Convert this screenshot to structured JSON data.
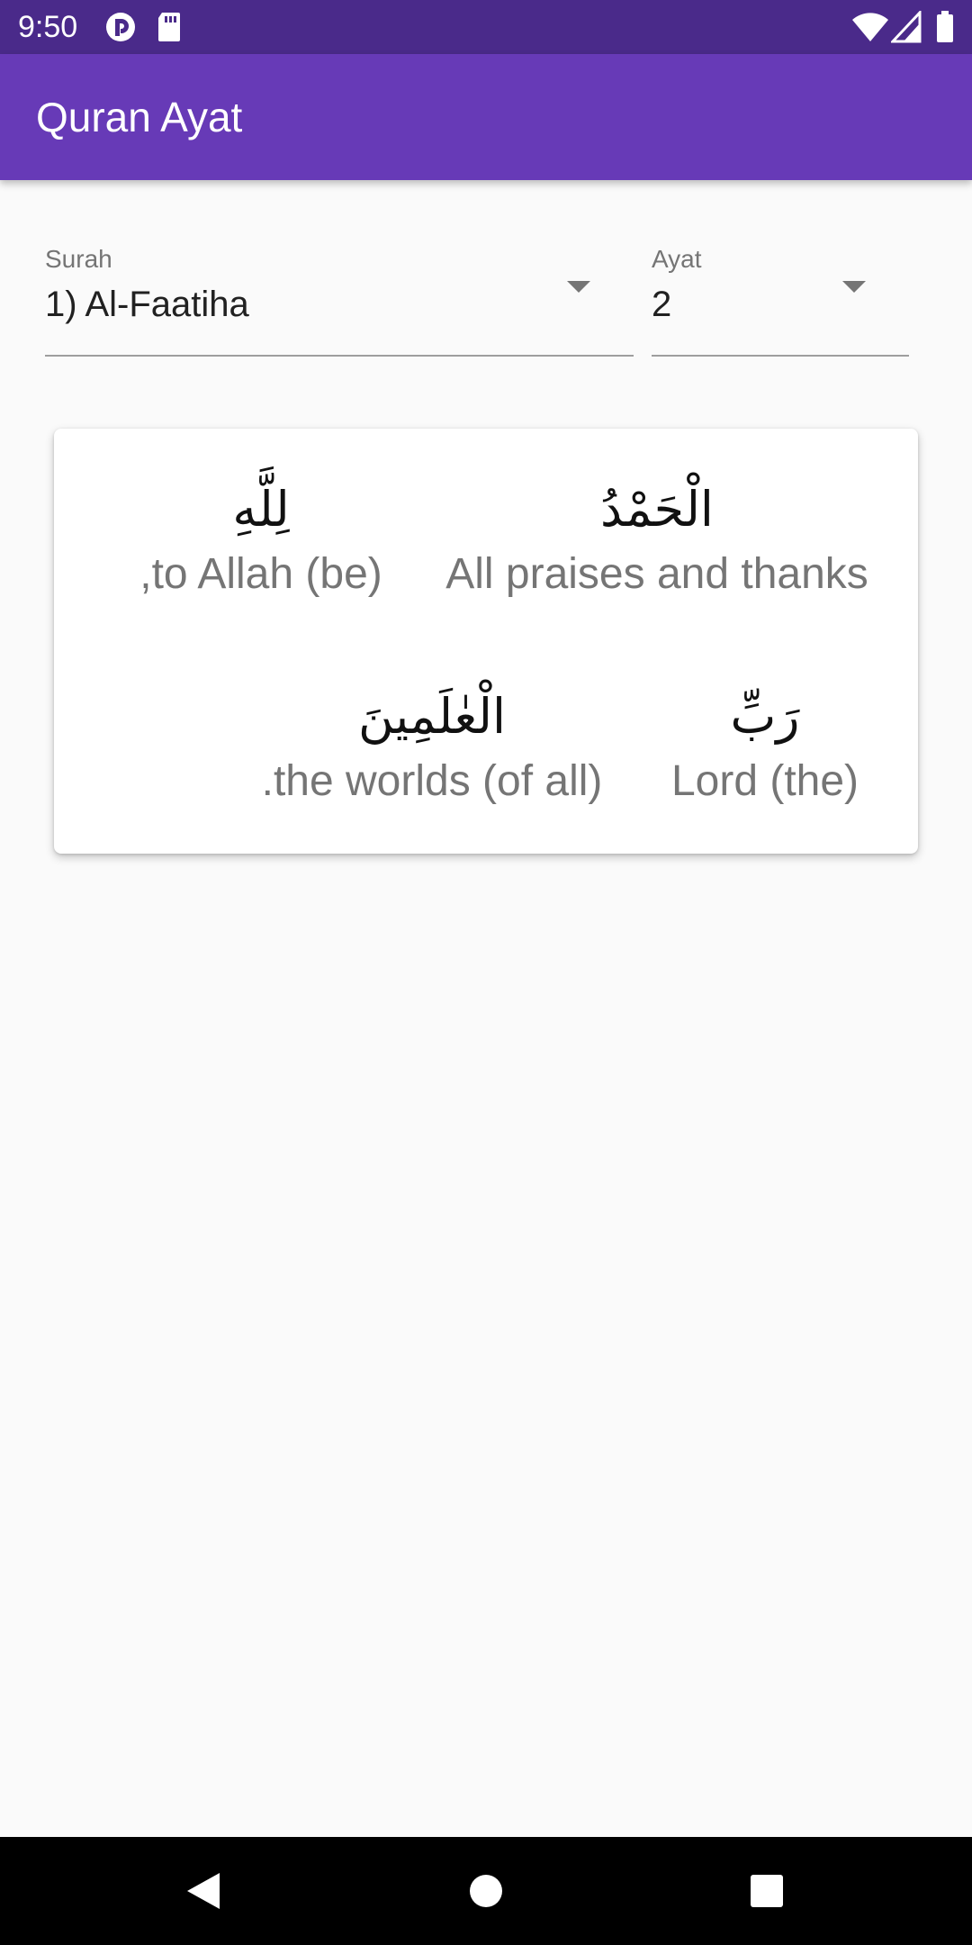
{
  "status_bar": {
    "time": "9:50",
    "icons": [
      "pocket-casts-icon",
      "sd-card-icon",
      "wifi-icon",
      "signal-icon",
      "battery-icon"
    ]
  },
  "app_bar": {
    "title": "Quran Ayat"
  },
  "selectors": {
    "surah": {
      "label": "Surah",
      "value": "1) Al-Faatiha"
    },
    "ayat": {
      "label": "Ayat",
      "value": "2"
    }
  },
  "ayah_words": [
    {
      "arabic": "الْحَمْدُ",
      "translation": "All praises and thanks"
    },
    {
      "arabic": "لِلَّهِ",
      "translation": "to Allah (be),"
    },
    {
      "arabic": "رَبِّ",
      "translation": "Lord (the)"
    },
    {
      "arabic": "الْعٰلَمِينَ",
      "translation": "the worlds (of all)."
    }
  ],
  "nav_bar": {
    "back": "back-icon",
    "home": "home-icon",
    "recents": "recents-icon"
  },
  "colors": {
    "status_bar": "#4a2a8a",
    "app_bar": "#673ab7",
    "background": "#fafafa",
    "card": "#ffffff",
    "translation_text": "#757575"
  }
}
